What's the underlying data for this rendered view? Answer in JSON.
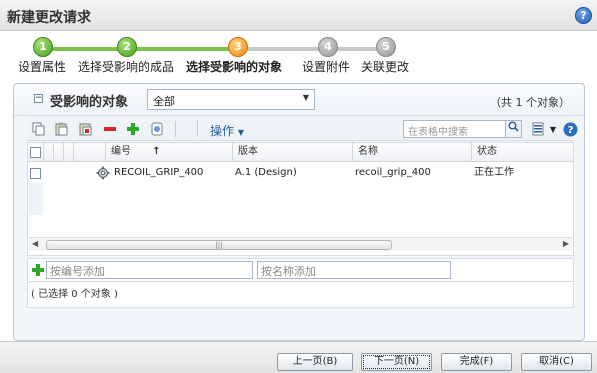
{
  "window": {
    "title": "新建更改请求"
  },
  "help_icon": "?",
  "wizard": {
    "steps": [
      {
        "num": "1",
        "label": "设置属性",
        "state": "done"
      },
      {
        "num": "2",
        "label": "选择受影响的成品",
        "state": "done"
      },
      {
        "num": "3",
        "label": "选择受影响的对象",
        "state": "current"
      },
      {
        "num": "4",
        "label": "设置附件",
        "state": "todo"
      },
      {
        "num": "5",
        "label": "关联更改",
        "state": "todo"
      }
    ]
  },
  "section": {
    "title": "受影响的对象",
    "filter_value": "全部",
    "count": "（共 1 个对象）"
  },
  "toolbar": {
    "icons": [
      "copy-icon",
      "paste-icon",
      "paste-special-icon",
      "remove-icon",
      "add-icon",
      "view-icon"
    ],
    "ops_label": "操作",
    "search_placeholder": "在表格中搜索"
  },
  "table": {
    "columns": {
      "number": "编号",
      "sort_indicator": "↑",
      "version": "版本",
      "name": "名称",
      "status": "状态"
    },
    "rows": [
      {
        "number": "RECOIL_GRIP_400",
        "version": "A.1 (Design)",
        "name": "recoil_grip_400",
        "status": "正在工作"
      }
    ],
    "scroll_grip": "|||"
  },
  "add": {
    "by_number_placeholder": "按编号添加",
    "by_name_placeholder": "按名称添加"
  },
  "selection_text": "( 已选择 0 个对象 )",
  "buttons": {
    "prev": "上一页(B)",
    "next": "下一页(N)",
    "finish": "完成(F)",
    "cancel": "取消(C)"
  },
  "colors": {
    "step_done": "#46a21e",
    "step_current": "#f08a10",
    "step_todo": "#999999",
    "remove_icon": "#d9262b",
    "add_icon": "#2ea82a",
    "link_blue": "#2a5d9a"
  }
}
